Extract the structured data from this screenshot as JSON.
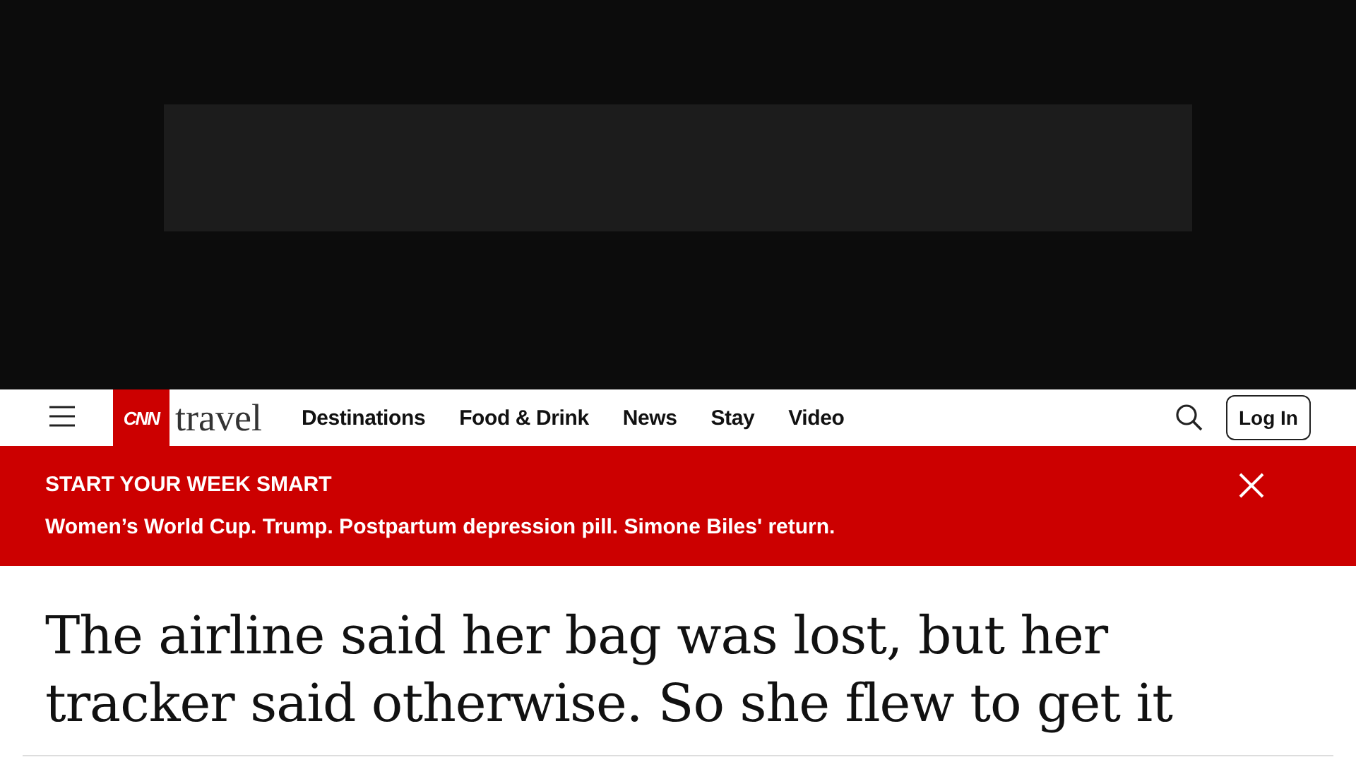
{
  "nav": {
    "logo": {
      "brand": "CNN",
      "section": "travel"
    },
    "links": [
      {
        "label": "Destinations"
      },
      {
        "label": "Food & Drink"
      },
      {
        "label": "News"
      },
      {
        "label": "Stay"
      },
      {
        "label": "Video"
      }
    ],
    "login": "Log In"
  },
  "banner": {
    "title": "START YOUR WEEK SMART",
    "text": "Women’s World Cup. Trump. Postpartum depression pill. Simone Biles' return."
  },
  "headline": "The airline said her bag was lost, but her tracker said otherwise. So she flew to get it"
}
